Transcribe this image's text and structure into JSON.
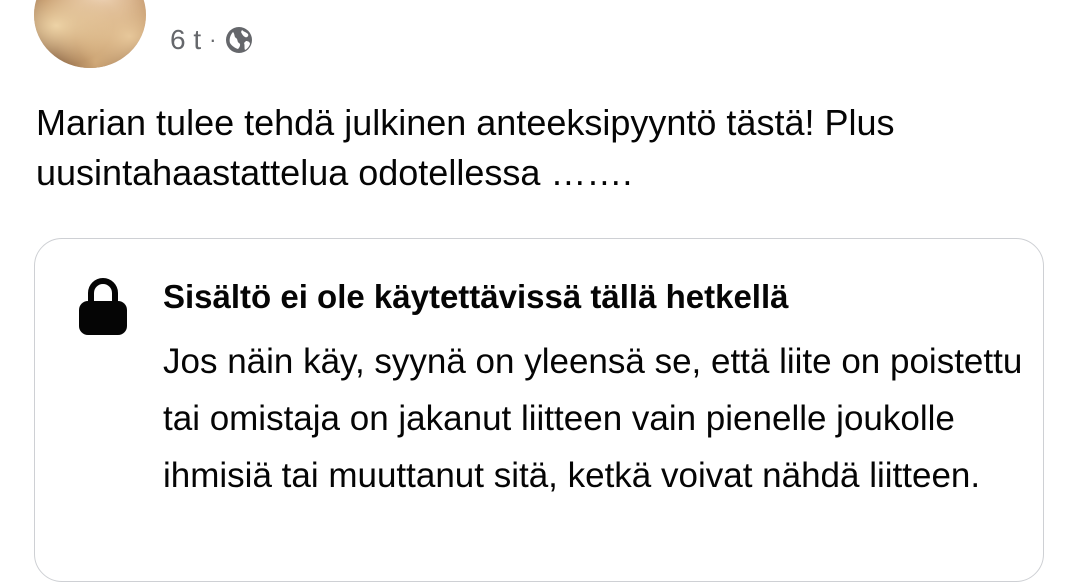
{
  "post": {
    "timestamp": "6 t",
    "separator": "·",
    "privacy_icon": "globe-icon",
    "text": "Marian tulee tehdä julkinen anteeksipyyntö tästä! Plus uusintahaastattelua odotellessa ……."
  },
  "attachment": {
    "icon": "lock-icon",
    "title": "Sisältö ei ole käytettävissä tällä hetkellä",
    "message": "Jos näin käy, syynä on yleensä se, että liite on poistettu tai omistaja on jakanut liitteen vain pienelle joukolle ihmisiä tai muuttanut sitä, ketkä voivat nähdä liitteen."
  },
  "colors": {
    "text": "#050505",
    "meta": "#65676b",
    "card_border": "#ced0d4"
  }
}
